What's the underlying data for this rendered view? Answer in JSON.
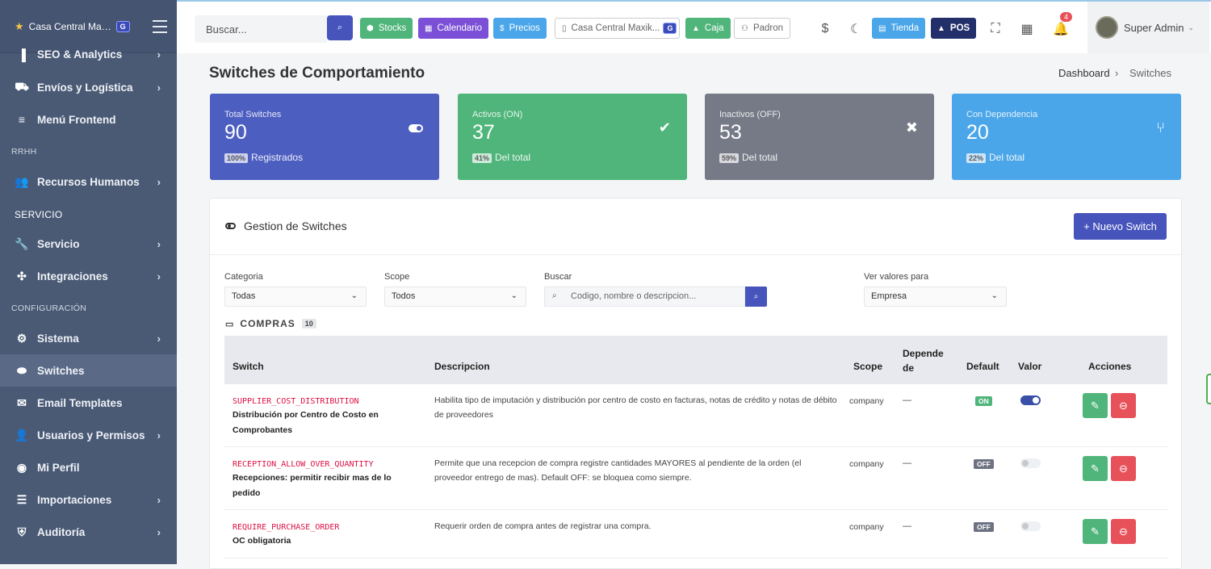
{
  "brand": {
    "name": "Casa Central Maxikiosko",
    "badge": "G"
  },
  "sidebar": {
    "items": [
      {
        "label": "SEO & Analytics",
        "icon": "chart-icon"
      },
      {
        "label": "Envíos y Logística",
        "icon": "truck-icon"
      },
      {
        "label": "Menú Frontend",
        "icon": "menu-icon"
      },
      {
        "label": "Recursos Humanos",
        "icon": "users-icon"
      },
      {
        "label": "Servicio",
        "icon": "wrench-icon"
      },
      {
        "label": "Integraciones",
        "icon": "puzzle-icon"
      },
      {
        "label": "Sistema",
        "icon": "gear-icon"
      },
      {
        "label": "Switches",
        "icon": "toggle-icon"
      },
      {
        "label": "Email Templates",
        "icon": "mail-icon"
      },
      {
        "label": "Usuarios y Permisos",
        "icon": "user-group-icon"
      },
      {
        "label": "Mi Perfil",
        "icon": "profile-icon"
      },
      {
        "label": "Importaciones",
        "icon": "database-icon"
      },
      {
        "label": "Auditoría",
        "icon": "shield-icon"
      }
    ],
    "sections": {
      "rrhh": "RRHH",
      "servicio": "SERVICIO",
      "config": "CONFIGURACIÓN"
    }
  },
  "topbar": {
    "search_placeholder": "Buscar...",
    "buttons": {
      "stocks": "Stocks",
      "calendario": "Calendario",
      "precios": "Precios",
      "branch": "Casa Central Maxik...",
      "branch_badge": "G",
      "caja": "Caja",
      "padron": "Padron",
      "tienda": "Tienda",
      "pos": "POS"
    },
    "notifications": "4",
    "user": "Super Admin"
  },
  "page": {
    "title": "Switches de Comportamiento",
    "breadcrumb": {
      "home": "Dashboard",
      "sep": "›",
      "current": "Switches"
    }
  },
  "stats": [
    {
      "label": "Total Switches",
      "value": "90",
      "pill": "100%",
      "foot": "Registrados",
      "color": "#4d5ec1"
    },
    {
      "label": "Activos (ON)",
      "value": "37",
      "pill": "41%",
      "foot": "Del total",
      "color": "#4fb57a"
    },
    {
      "label": "Inactivos (OFF)",
      "value": "53",
      "pill": "59%",
      "foot": "Del total",
      "color": "#767a87"
    },
    {
      "label": "Con Dependencia",
      "value": "20",
      "pill": "22%",
      "foot": "Del total",
      "color": "#4ba6e9"
    }
  ],
  "panel": {
    "title": "Gestion de Switches",
    "new_button": "+ Nuevo Switch",
    "filters": {
      "categoria_label": "Categoria",
      "categoria_value": "Todas",
      "scope_label": "Scope",
      "scope_value": "Todos",
      "buscar_label": "Buscar",
      "buscar_placeholder": "Codigo, nombre o descripcion...",
      "ver_label": "Ver valores para",
      "ver_value": "Empresa"
    },
    "group": {
      "name": "COMPRAS",
      "count": "10"
    },
    "columns": {
      "switch": "Switch",
      "descripcion": "Descripcion",
      "scope": "Scope",
      "depende": "Depende de",
      "default": "Default",
      "valor": "Valor",
      "acciones": "Acciones"
    },
    "rows": [
      {
        "code": "SUPPLIER_COST_DISTRIBUTION",
        "name": "Distribución por Centro de Costo en Comprobantes",
        "desc": "Habilita tipo de imputación y distribución por centro de costo en facturas, notas de crédito y notas de débito de proveedores",
        "scope": "company",
        "dep": "—",
        "default": "ON",
        "valor": true
      },
      {
        "code": "RECEPTION_ALLOW_OVER_QUANTITY",
        "name": "Recepciones: permitir recibir mas de lo pedido",
        "desc": "Permite que una recepcion de compra registre cantidades MAYORES al pendiente de la orden (el proveedor entrego de mas). Default OFF: se bloquea como siempre.",
        "scope": "company",
        "dep": "—",
        "default": "OFF",
        "valor": false
      },
      {
        "code": "REQUIRE_PURCHASE_ORDER",
        "name": "OC obligatoria",
        "desc": "Requerir orden de compra antes de registrar una compra.",
        "scope": "company",
        "dep": "—",
        "default": "OFF",
        "valor": false
      }
    ]
  }
}
